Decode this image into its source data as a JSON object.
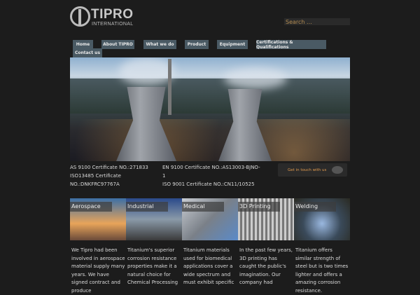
{
  "logo": {
    "name": "TIPRO",
    "sub": "INTERNATIONAL"
  },
  "search": {
    "placeholder": "Search ..."
  },
  "nav": [
    {
      "label": "Home"
    },
    {
      "label": "About TIPRO"
    },
    {
      "label": "What we do"
    },
    {
      "label": "Product"
    },
    {
      "label": "Equipment"
    },
    {
      "label": "Certifications & Qualifications"
    },
    {
      "label": "Contact us"
    }
  ],
  "certs": {
    "left": "AS 9100 Certificate NO.:271833\nISO13485 Certificate\nNO.:DNKFRC97767A",
    "right": "EN 9100 Certificate NO.:AS13003-BJNO-\n1\nISO 9001 Certificate NO.:CN11/10525"
  },
  "contact_label": "Get in touch with us",
  "cards": [
    {
      "title": "Aerospace",
      "text": "We Tipro had been involved in aerospace material supply many years. We have signed contract and produce"
    },
    {
      "title": "Industrial",
      "text": "Titanium's superior corrosion resistance properties make it a natural choice for Chemical Processing"
    },
    {
      "title": "Medical",
      "text": "Titanium materials used for biomedical applications cover a wide spectrum and must exhibit specific"
    },
    {
      "title": "3D Printing",
      "text": "In the past few years, 3D printing has caught the public's imagination. Our company had"
    },
    {
      "title": "Welding",
      "text": "Titanium offers similar strength of steel but is two times lighter and offers a amazing corrosion resistance."
    }
  ]
}
